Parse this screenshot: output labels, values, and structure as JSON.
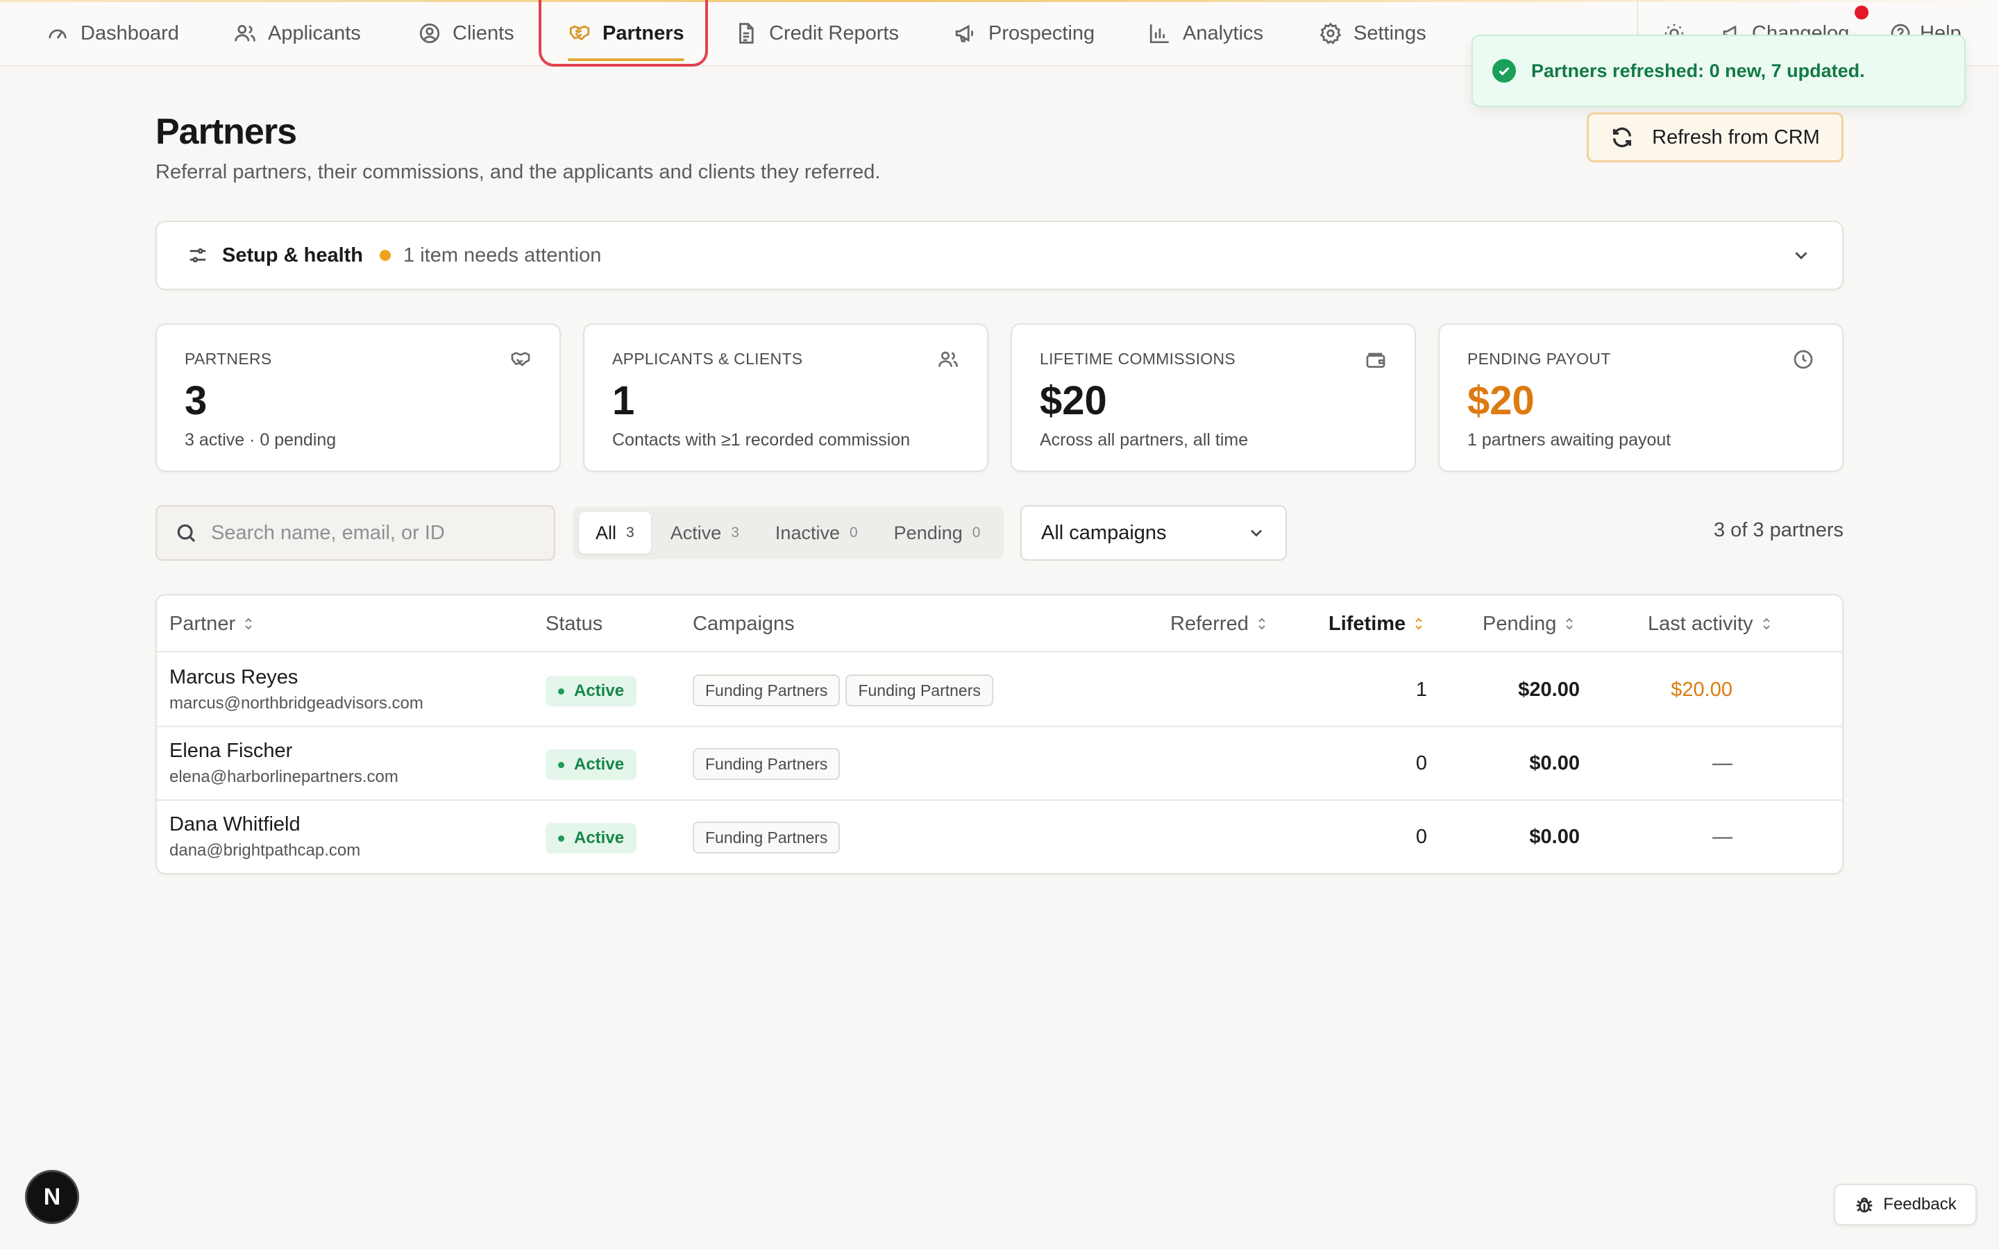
{
  "nav": {
    "items": [
      {
        "label": "Dashboard",
        "icon": "gauge-icon"
      },
      {
        "label": "Applicants",
        "icon": "users-icon"
      },
      {
        "label": "Clients",
        "icon": "user-circle-icon"
      },
      {
        "label": "Partners",
        "icon": "handshake-icon",
        "active": true
      },
      {
        "label": "Credit Reports",
        "icon": "file-text-icon"
      },
      {
        "label": "Prospecting",
        "icon": "megaphone-icon"
      },
      {
        "label": "Analytics",
        "icon": "bar-chart-icon"
      },
      {
        "label": "Settings",
        "icon": "gear-icon"
      }
    ],
    "right": {
      "theme_icon": "sun-icon",
      "changelog_label": "Changelog",
      "help_label": "Help"
    }
  },
  "toast": {
    "message": "Partners refreshed: 0 new, 7 updated."
  },
  "header": {
    "title": "Partners",
    "subtitle": "Referral partners, their commissions, and the applicants and clients they referred.",
    "refresh_label": "Refresh from CRM"
  },
  "setup": {
    "title": "Setup & health",
    "note": "1 item needs attention"
  },
  "stats": [
    {
      "label": "Partners",
      "value": "3",
      "sub": "3 active · 0 pending",
      "icon": "handshake-icon"
    },
    {
      "label": "Applicants & Clients",
      "value": "1",
      "sub": "Contacts with ≥1 recorded commission",
      "icon": "users-icon"
    },
    {
      "label": "Lifetime Commissions",
      "value": "$20",
      "sub": "Across all partners, all time",
      "icon": "wallet-icon"
    },
    {
      "label": "Pending Payout",
      "value": "$20",
      "sub": "1 partners awaiting payout",
      "icon": "clock-icon"
    }
  ],
  "filters": {
    "search_placeholder": "Search name, email, or ID",
    "segments": [
      {
        "label": "All",
        "count": "3",
        "active": true
      },
      {
        "label": "Active",
        "count": "3"
      },
      {
        "label": "Inactive",
        "count": "0"
      },
      {
        "label": "Pending",
        "count": "0"
      }
    ],
    "campaign_select": "All campaigns",
    "count_label": "3 of 3 partners"
  },
  "table": {
    "columns": {
      "partner": "Partner",
      "status": "Status",
      "campaigns": "Campaigns",
      "referred": "Referred",
      "lifetime": "Lifetime",
      "pending": "Pending",
      "last_activity": "Last activity"
    },
    "rows": [
      {
        "name": "Marcus Reyes",
        "email": "marcus@northbridgeadvisors.com",
        "status": "Active",
        "campaigns": [
          "Funding Partners",
          "Funding Partners"
        ],
        "referred": "1",
        "lifetime": "$20.00",
        "pending": "$20.00",
        "last_activity": "—"
      },
      {
        "name": "Elena Fischer",
        "email": "elena@harborlinepartners.com",
        "status": "Active",
        "campaigns": [
          "Funding Partners"
        ],
        "referred": "0",
        "lifetime": "$0.00",
        "pending": "—",
        "last_activity": "—"
      },
      {
        "name": "Dana Whitfield",
        "email": "dana@brightpathcap.com",
        "status": "Active",
        "campaigns": [
          "Funding Partners"
        ],
        "referred": "0",
        "lifetime": "$0.00",
        "pending": "—",
        "last_activity": "—"
      }
    ]
  },
  "widgets": {
    "dev_badge": "N",
    "feedback_label": "Feedback"
  },
  "colors": {
    "accent": "#e4a93c",
    "active_outline": "#e0424e",
    "success": "#1aa05b",
    "pending_orange": "#dd7a12"
  }
}
